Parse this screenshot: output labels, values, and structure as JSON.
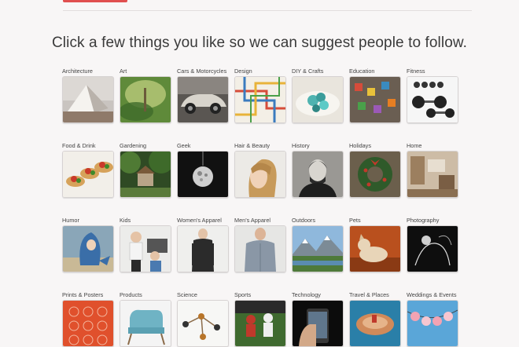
{
  "header": {
    "accent_color": "#e04f4f"
  },
  "prompt": {
    "text": "Click a few things you like so we can suggest people to follow."
  },
  "categories": [
    {
      "label": "Architecture",
      "icon": "architecture-photo"
    },
    {
      "label": "Art",
      "icon": "art-photo"
    },
    {
      "label": "Cars & Motorcycles",
      "icon": "car-photo"
    },
    {
      "label": "Design",
      "icon": "design-photo"
    },
    {
      "label": "DIY & Crafts",
      "icon": "diy-crafts-photo"
    },
    {
      "label": "Education",
      "icon": "education-photo"
    },
    {
      "label": "Fitness",
      "icon": "fitness-photo"
    },
    {
      "label": "Food & Drink",
      "icon": "food-drink-photo"
    },
    {
      "label": "Gardening",
      "icon": "gardening-photo"
    },
    {
      "label": "Geek",
      "icon": "geek-photo"
    },
    {
      "label": "Hair & Beauty",
      "icon": "hair-beauty-photo"
    },
    {
      "label": "History",
      "icon": "history-photo"
    },
    {
      "label": "Holidays",
      "icon": "holidays-photo"
    },
    {
      "label": "Home",
      "icon": "home-photo"
    },
    {
      "label": "Humor",
      "icon": "humor-photo"
    },
    {
      "label": "Kids",
      "icon": "kids-photo"
    },
    {
      "label": "Women's Apparel",
      "icon": "womens-apparel-photo"
    },
    {
      "label": "Men's Apparel",
      "icon": "mens-apparel-photo"
    },
    {
      "label": "Outdoors",
      "icon": "outdoors-photo"
    },
    {
      "label": "Pets",
      "icon": "pets-photo"
    },
    {
      "label": "Photography",
      "icon": "photography-photo"
    },
    {
      "label": "Prints & Posters",
      "icon": "prints-posters-photo"
    },
    {
      "label": "Products",
      "icon": "products-photo"
    },
    {
      "label": "Science",
      "icon": "science-photo"
    },
    {
      "label": "Sports",
      "icon": "sports-photo"
    },
    {
      "label": "Technology",
      "icon": "technology-photo"
    },
    {
      "label": "Travel & Places",
      "icon": "travel-places-photo"
    },
    {
      "label": "Weddings & Events",
      "icon": "weddings-events-photo"
    }
  ]
}
